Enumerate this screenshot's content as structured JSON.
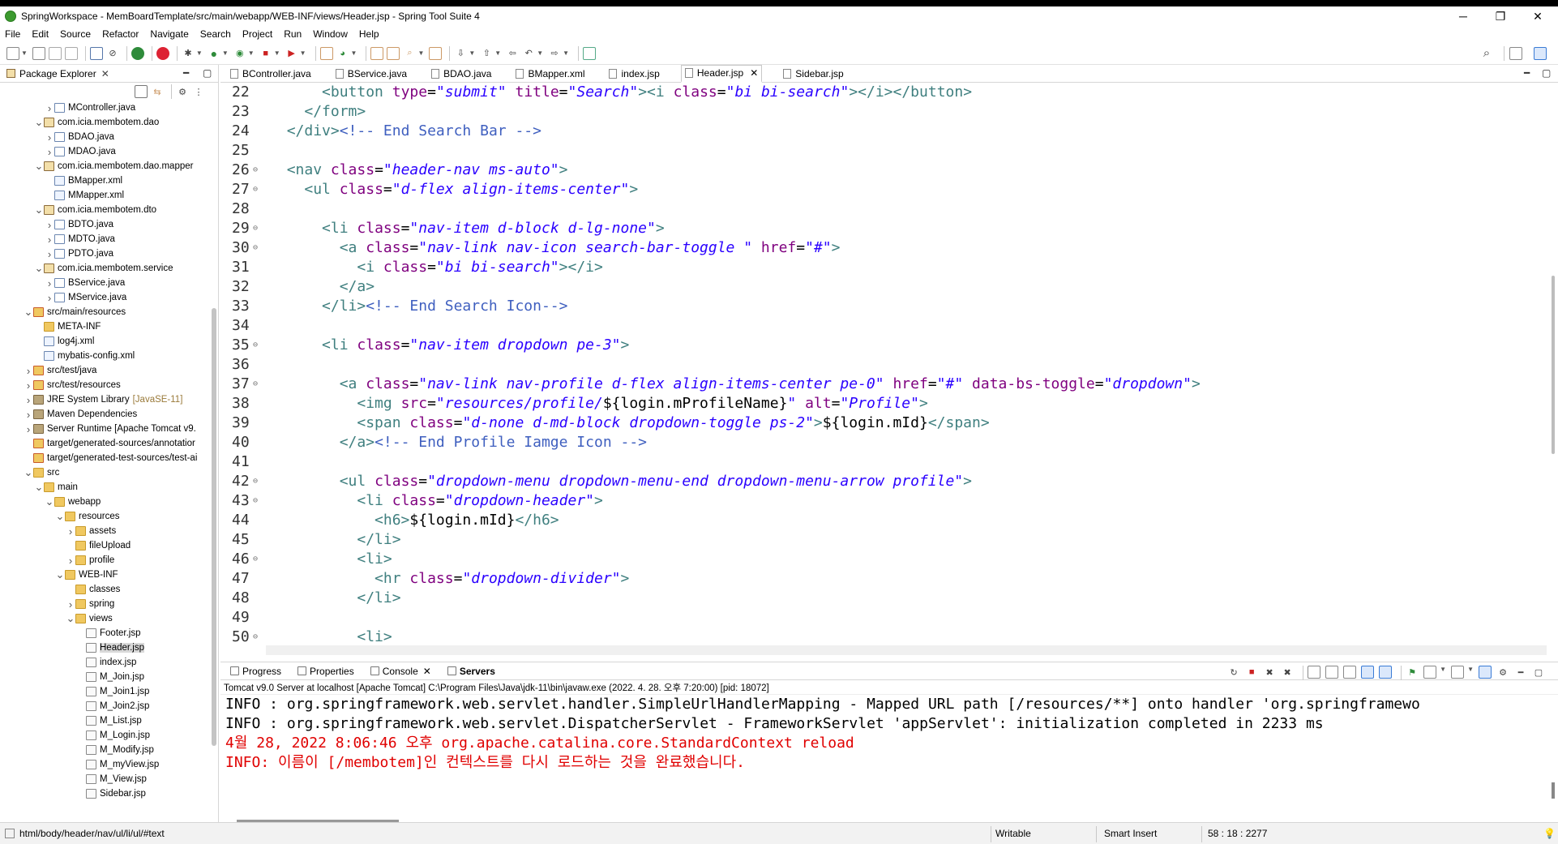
{
  "window": {
    "title": "SpringWorkspace - MemBoardTemplate/src/main/webapp/WEB-INF/views/Header.jsp - Spring Tool Suite 4",
    "minimize": "─",
    "maximize": "❐",
    "close": "✕"
  },
  "menu": [
    "File",
    "Edit",
    "Source",
    "Refactor",
    "Navigate",
    "Search",
    "Project",
    "Run",
    "Window",
    "Help"
  ],
  "package_explorer": {
    "tab_label": "Package Explorer",
    "items": [
      {
        "label": "MController.java",
        "depth": 3,
        "icon": "java",
        "twisty": ">"
      },
      {
        "label": "com.icia.membotem.dao",
        "depth": 2,
        "icon": "pkg",
        "twisty": "v"
      },
      {
        "label": "BDAO.java",
        "depth": 3,
        "icon": "java",
        "twisty": ">"
      },
      {
        "label": "MDAO.java",
        "depth": 3,
        "icon": "java",
        "twisty": ">"
      },
      {
        "label": "com.icia.membotem.dao.mapper",
        "depth": 2,
        "icon": "pkg",
        "twisty": "v"
      },
      {
        "label": "BMapper.xml",
        "depth": 3,
        "icon": "xml",
        "twisty": ""
      },
      {
        "label": "MMapper.xml",
        "depth": 3,
        "icon": "xml",
        "twisty": ""
      },
      {
        "label": "com.icia.membotem.dto",
        "depth": 2,
        "icon": "pkg",
        "twisty": "v"
      },
      {
        "label": "BDTO.java",
        "depth": 3,
        "icon": "java",
        "twisty": ">"
      },
      {
        "label": "MDTO.java",
        "depth": 3,
        "icon": "java",
        "twisty": ">"
      },
      {
        "label": "PDTO.java",
        "depth": 3,
        "icon": "java",
        "twisty": ">"
      },
      {
        "label": "com.icia.membotem.service",
        "depth": 2,
        "icon": "pkg",
        "twisty": "v"
      },
      {
        "label": "BService.java",
        "depth": 3,
        "icon": "java",
        "twisty": ">"
      },
      {
        "label": "MService.java",
        "depth": 3,
        "icon": "java",
        "twisty": ">"
      },
      {
        "label": "src/main/resources",
        "depth": 1,
        "icon": "src",
        "twisty": "v"
      },
      {
        "label": "META-INF",
        "depth": 2,
        "icon": "fold",
        "twisty": ""
      },
      {
        "label": "log4j.xml",
        "depth": 2,
        "icon": "xml",
        "twisty": ""
      },
      {
        "label": "mybatis-config.xml",
        "depth": 2,
        "icon": "xml",
        "twisty": ""
      },
      {
        "label": "src/test/java",
        "depth": 1,
        "icon": "src",
        "twisty": ">"
      },
      {
        "label": "src/test/resources",
        "depth": 1,
        "icon": "src",
        "twisty": ">"
      },
      {
        "label": "JRE System Library",
        "suffix": "[JavaSE-11]",
        "depth": 1,
        "icon": "lib",
        "twisty": ">"
      },
      {
        "label": "Maven Dependencies",
        "depth": 1,
        "icon": "lib",
        "twisty": ">"
      },
      {
        "label": "Server Runtime [Apache Tomcat v9.",
        "depth": 1,
        "icon": "lib",
        "twisty": ">"
      },
      {
        "label": "target/generated-sources/annotatior",
        "depth": 1,
        "icon": "src",
        "twisty": ""
      },
      {
        "label": "target/generated-test-sources/test-ai",
        "depth": 1,
        "icon": "src",
        "twisty": ""
      },
      {
        "label": "src",
        "depth": 1,
        "icon": "fold",
        "twisty": "v"
      },
      {
        "label": "main",
        "depth": 2,
        "icon": "fold",
        "twisty": "v"
      },
      {
        "label": "webapp",
        "depth": 3,
        "icon": "fold",
        "twisty": "v"
      },
      {
        "label": "resources",
        "depth": 4,
        "icon": "fold",
        "twisty": "v"
      },
      {
        "label": "assets",
        "depth": 5,
        "icon": "fold",
        "twisty": ">"
      },
      {
        "label": "fileUpload",
        "depth": 5,
        "icon": "fold",
        "twisty": ""
      },
      {
        "label": "profile",
        "depth": 5,
        "icon": "fold",
        "twisty": ">"
      },
      {
        "label": "WEB-INF",
        "depth": 4,
        "icon": "fold",
        "twisty": "v"
      },
      {
        "label": "classes",
        "depth": 5,
        "icon": "fold",
        "twisty": ""
      },
      {
        "label": "spring",
        "depth": 5,
        "icon": "fold",
        "twisty": ">"
      },
      {
        "label": "views",
        "depth": 5,
        "icon": "fold",
        "twisty": "v"
      },
      {
        "label": "Footer.jsp",
        "depth": 6,
        "icon": "jsp",
        "twisty": ""
      },
      {
        "label": "Header.jsp",
        "depth": 6,
        "icon": "jsp",
        "twisty": "",
        "selected": true
      },
      {
        "label": "index.jsp",
        "depth": 6,
        "icon": "jsp",
        "twisty": ""
      },
      {
        "label": "M_Join.jsp",
        "depth": 6,
        "icon": "jsp",
        "twisty": ""
      },
      {
        "label": "M_Join1.jsp",
        "depth": 6,
        "icon": "jsp",
        "twisty": ""
      },
      {
        "label": "M_Join2.jsp",
        "depth": 6,
        "icon": "jsp",
        "twisty": ""
      },
      {
        "label": "M_List.jsp",
        "depth": 6,
        "icon": "jsp",
        "twisty": ""
      },
      {
        "label": "M_Login.jsp",
        "depth": 6,
        "icon": "jsp",
        "twisty": ""
      },
      {
        "label": "M_Modify.jsp",
        "depth": 6,
        "icon": "jsp",
        "twisty": ""
      },
      {
        "label": "M_myView.jsp",
        "depth": 6,
        "icon": "jsp",
        "twisty": ""
      },
      {
        "label": "M_View.jsp",
        "depth": 6,
        "icon": "jsp",
        "twisty": ""
      },
      {
        "label": "Sidebar.jsp",
        "depth": 6,
        "icon": "jsp",
        "twisty": ""
      }
    ]
  },
  "editor": {
    "tabs": [
      {
        "label": "BController.java",
        "active": false
      },
      {
        "label": "BService.java",
        "active": false
      },
      {
        "label": "BDAO.java",
        "active": false
      },
      {
        "label": "BMapper.xml",
        "active": false
      },
      {
        "label": "index.jsp",
        "active": false
      },
      {
        "label": "Header.jsp",
        "active": true
      },
      {
        "label": "Sidebar.jsp",
        "active": false
      }
    ],
    "lines": [
      {
        "n": "22",
        "fold": "",
        "indent": 6,
        "tokens": [
          [
            "tg",
            "<button "
          ],
          [
            "at",
            "type"
          ],
          [
            "tx",
            "="
          ],
          [
            "av",
            "\"submit\""
          ],
          [
            "tx",
            " "
          ],
          [
            "at",
            "title"
          ],
          [
            "tx",
            "="
          ],
          [
            "av",
            "\"Search\""
          ],
          [
            "tg",
            "><i "
          ],
          [
            "at",
            "class"
          ],
          [
            "tx",
            "="
          ],
          [
            "av",
            "\"bi bi-search\""
          ],
          [
            "tg",
            "></i></button>"
          ]
        ]
      },
      {
        "n": "23",
        "fold": "",
        "indent": 4,
        "tokens": [
          [
            "tg",
            "</form>"
          ]
        ]
      },
      {
        "n": "24",
        "fold": "",
        "indent": 2,
        "tokens": [
          [
            "tg",
            "</div>"
          ],
          [
            "cm",
            "<!-- End Search Bar -->"
          ]
        ]
      },
      {
        "n": "25",
        "fold": "",
        "indent": 0,
        "tokens": []
      },
      {
        "n": "26",
        "fold": "⊖",
        "indent": 2,
        "tokens": [
          [
            "tg",
            "<nav "
          ],
          [
            "at",
            "class"
          ],
          [
            "tx",
            "="
          ],
          [
            "av",
            "\"header-nav ms-auto\""
          ],
          [
            "tg",
            ">"
          ]
        ]
      },
      {
        "n": "27",
        "fold": "⊖",
        "indent": 4,
        "tokens": [
          [
            "tg",
            "<ul "
          ],
          [
            "at",
            "class"
          ],
          [
            "tx",
            "="
          ],
          [
            "av",
            "\"d-flex align-items-center\""
          ],
          [
            "tg",
            ">"
          ]
        ]
      },
      {
        "n": "28",
        "fold": "",
        "indent": 0,
        "tokens": []
      },
      {
        "n": "29",
        "fold": "⊖",
        "indent": 6,
        "tokens": [
          [
            "tg",
            "<li "
          ],
          [
            "at",
            "class"
          ],
          [
            "tx",
            "="
          ],
          [
            "av",
            "\"nav-item d-block d-lg-none\""
          ],
          [
            "tg",
            ">"
          ]
        ]
      },
      {
        "n": "30",
        "fold": "⊖",
        "indent": 8,
        "tokens": [
          [
            "tg",
            "<a "
          ],
          [
            "at",
            "class"
          ],
          [
            "tx",
            "="
          ],
          [
            "av",
            "\"nav-link nav-icon search-bar-toggle \""
          ],
          [
            "tx",
            " "
          ],
          [
            "at",
            "href"
          ],
          [
            "tx",
            "="
          ],
          [
            "av",
            "\"#\""
          ],
          [
            "tg",
            ">"
          ]
        ]
      },
      {
        "n": "31",
        "fold": "",
        "indent": 10,
        "tokens": [
          [
            "tg",
            "<i "
          ],
          [
            "at",
            "class"
          ],
          [
            "tx",
            "="
          ],
          [
            "av",
            "\"bi bi-search\""
          ],
          [
            "tg",
            "></i>"
          ]
        ]
      },
      {
        "n": "32",
        "fold": "",
        "indent": 8,
        "tokens": [
          [
            "tg",
            "</a>"
          ]
        ]
      },
      {
        "n": "33",
        "fold": "",
        "indent": 6,
        "tokens": [
          [
            "tg",
            "</li>"
          ],
          [
            "cm",
            "<!-- End Search Icon-->"
          ]
        ]
      },
      {
        "n": "34",
        "fold": "",
        "indent": 0,
        "tokens": []
      },
      {
        "n": "35",
        "fold": "⊖",
        "indent": 6,
        "tokens": [
          [
            "tg",
            "<li "
          ],
          [
            "at",
            "class"
          ],
          [
            "tx",
            "="
          ],
          [
            "av",
            "\"nav-item dropdown pe-3\""
          ],
          [
            "tg",
            ">"
          ]
        ]
      },
      {
        "n": "36",
        "fold": "",
        "indent": 0,
        "tokens": []
      },
      {
        "n": "37",
        "fold": "⊖",
        "indent": 8,
        "tokens": [
          [
            "tg",
            "<a "
          ],
          [
            "at",
            "class"
          ],
          [
            "tx",
            "="
          ],
          [
            "av",
            "\"nav-link nav-profile d-flex align-items-center pe-0\""
          ],
          [
            "tx",
            " "
          ],
          [
            "at",
            "href"
          ],
          [
            "tx",
            "="
          ],
          [
            "av",
            "\"#\""
          ],
          [
            "tx",
            " "
          ],
          [
            "at",
            "data-bs-toggle"
          ],
          [
            "tx",
            "="
          ],
          [
            "av",
            "\"dropdown\""
          ],
          [
            "tg",
            ">"
          ]
        ]
      },
      {
        "n": "38",
        "fold": "",
        "indent": 10,
        "tokens": [
          [
            "tg",
            "<img "
          ],
          [
            "at",
            "src"
          ],
          [
            "tx",
            "="
          ],
          [
            "av",
            "\"resources/profile/"
          ],
          [
            "tx",
            "${login.mProfileName}"
          ],
          [
            "av",
            "\""
          ],
          [
            "tx",
            " "
          ],
          [
            "at",
            "alt"
          ],
          [
            "tx",
            "="
          ],
          [
            "av",
            "\"Profile\""
          ],
          [
            "tg",
            ">"
          ]
        ]
      },
      {
        "n": "39",
        "fold": "",
        "indent": 10,
        "tokens": [
          [
            "tg",
            "<span "
          ],
          [
            "at",
            "class"
          ],
          [
            "tx",
            "="
          ],
          [
            "av",
            "\"d-none d-md-block dropdown-toggle ps-2\""
          ],
          [
            "tg",
            ">"
          ],
          [
            "tx",
            "${login.mId}"
          ],
          [
            "tg",
            "</span>"
          ]
        ]
      },
      {
        "n": "40",
        "fold": "",
        "indent": 8,
        "tokens": [
          [
            "tg",
            "</a>"
          ],
          [
            "cm",
            "<!-- End Profile Iamge Icon -->"
          ]
        ]
      },
      {
        "n": "41",
        "fold": "",
        "indent": 0,
        "tokens": []
      },
      {
        "n": "42",
        "fold": "⊖",
        "indent": 8,
        "tokens": [
          [
            "tg",
            "<ul "
          ],
          [
            "at",
            "class"
          ],
          [
            "tx",
            "="
          ],
          [
            "av",
            "\"dropdown-menu dropdown-menu-end dropdown-menu-arrow profile\""
          ],
          [
            "tg",
            ">"
          ]
        ]
      },
      {
        "n": "43",
        "fold": "⊖",
        "indent": 10,
        "tokens": [
          [
            "tg",
            "<li "
          ],
          [
            "at",
            "class"
          ],
          [
            "tx",
            "="
          ],
          [
            "av",
            "\"dropdown-header\""
          ],
          [
            "tg",
            ">"
          ]
        ]
      },
      {
        "n": "44",
        "fold": "",
        "indent": 12,
        "tokens": [
          [
            "tg",
            "<h6>"
          ],
          [
            "tx",
            "${login.mId}"
          ],
          [
            "tg",
            "</h6>"
          ]
        ]
      },
      {
        "n": "45",
        "fold": "",
        "indent": 10,
        "tokens": [
          [
            "tg",
            "</li>"
          ]
        ]
      },
      {
        "n": "46",
        "fold": "⊖",
        "indent": 10,
        "tokens": [
          [
            "tg",
            "<li>"
          ]
        ]
      },
      {
        "n": "47",
        "fold": "",
        "indent": 12,
        "tokens": [
          [
            "tg",
            "<hr "
          ],
          [
            "at",
            "class"
          ],
          [
            "tx",
            "="
          ],
          [
            "av",
            "\"dropdown-divider\""
          ],
          [
            "tg",
            ">"
          ]
        ]
      },
      {
        "n": "48",
        "fold": "",
        "indent": 10,
        "tokens": [
          [
            "tg",
            "</li>"
          ]
        ]
      },
      {
        "n": "49",
        "fold": "",
        "indent": 0,
        "tokens": []
      },
      {
        "n": "50",
        "fold": "⊖",
        "indent": 10,
        "tokens": [
          [
            "tg",
            "<li>"
          ]
        ]
      }
    ]
  },
  "bottom_panel": {
    "tabs": [
      {
        "label": "Progress",
        "active": false,
        "closable": false
      },
      {
        "label": "Properties",
        "active": false,
        "closable": false
      },
      {
        "label": "Console",
        "active": true,
        "closable": true
      },
      {
        "label": "Servers",
        "active": false,
        "closable": false,
        "bold": true
      }
    ],
    "console_header": "Tomcat v9.0 Server at localhost [Apache Tomcat] C:\\Program Files\\Java\\jdk-11\\bin\\javaw.exe  (2022. 4. 28. 오후 7:20:00) [pid: 18072]",
    "lines": [
      {
        "text": "INFO : org.springframework.web.servlet.handler.SimpleUrlHandlerMapping - Mapped URL path [/resources/**] onto handler 'org.springframewo",
        "error": false
      },
      {
        "text": "INFO : org.springframework.web.servlet.DispatcherServlet - FrameworkServlet 'appServlet': initialization completed in 2233 ms",
        "error": false
      },
      {
        "text": "4월 28, 2022 8:06:46 오후 org.apache.catalina.core.StandardContext reload",
        "error": true
      },
      {
        "text": "INFO: 이름이 [/membotem]인 컨텍스트를 다시 로드하는 것을 완료했습니다.",
        "error": true
      }
    ]
  },
  "statusbar": {
    "path": "html/body/header/nav/ul/li/ul/#text",
    "writable": "Writable",
    "insert_mode": "Smart Insert",
    "position": "58 : 18 : 2277"
  },
  "colors": {
    "tag": "#3f7f7f",
    "attr": "#7f007f",
    "value": "#2a00ff",
    "comment": "#3f5fbf",
    "error": "#e00000"
  }
}
